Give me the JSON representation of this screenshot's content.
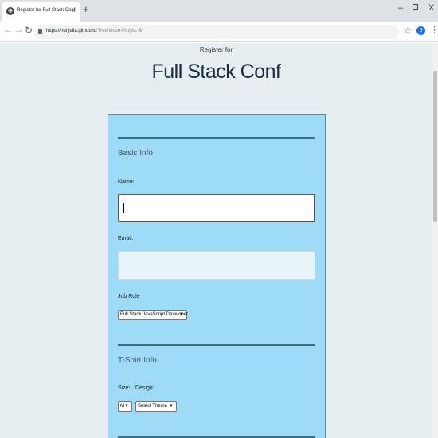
{
  "browser": {
    "tab_title": "Register for Full Stack Conf",
    "tab_close": "×",
    "new_tab": "+",
    "window_min": "–",
    "window_close": "X",
    "url_host": "https://nunjulia.github.io",
    "url_path": "/Treehouse-Project-3/",
    "profile_initial": "J"
  },
  "header": {
    "pre_title": "Register for",
    "title": "Full Stack Conf"
  },
  "basic_info": {
    "legend": "Basic Info",
    "name_label": "Name:",
    "email_label": "Email:",
    "job_role_label": "Job Role",
    "job_role_value": "Full Stack JavaScript Developer"
  },
  "tshirt_info": {
    "legend": "T-Shirt Info",
    "size_label": "Size:",
    "design_label": "Design:",
    "size_value": "M",
    "design_value": "Select Theme"
  },
  "colors": {
    "panel": "#9edbf6",
    "page_bg": "#e7eef2",
    "divider": "#3f6e7c"
  }
}
